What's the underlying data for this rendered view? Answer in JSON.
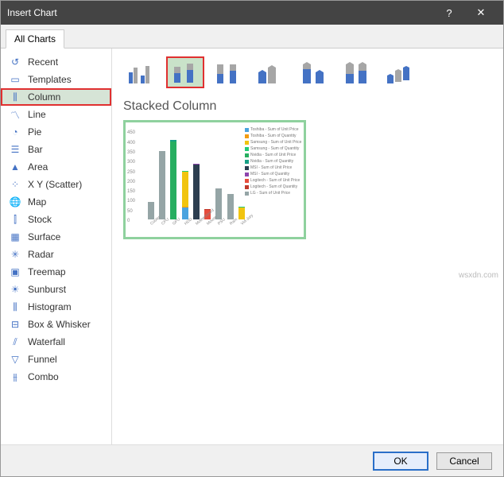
{
  "window": {
    "title": "Insert Chart",
    "help": "?",
    "close": "✕"
  },
  "tabs": {
    "all": "All Charts"
  },
  "sidebar": {
    "items": [
      {
        "label": "Recent"
      },
      {
        "label": "Templates"
      },
      {
        "label": "Column"
      },
      {
        "label": "Line"
      },
      {
        "label": "Pie"
      },
      {
        "label": "Bar"
      },
      {
        "label": "Area"
      },
      {
        "label": "X Y (Scatter)"
      },
      {
        "label": "Map"
      },
      {
        "label": "Stock"
      },
      {
        "label": "Surface"
      },
      {
        "label": "Radar"
      },
      {
        "label": "Treemap"
      },
      {
        "label": "Sunburst"
      },
      {
        "label": "Histogram"
      },
      {
        "label": "Box & Whisker"
      },
      {
        "label": "Waterfall"
      },
      {
        "label": "Funnel"
      },
      {
        "label": "Combo"
      }
    ],
    "selected_index": 2
  },
  "content": {
    "subtype_selected": 1,
    "chart_name": "Stacked Column"
  },
  "chart_data": {
    "type": "bar",
    "stacked": true,
    "title": "",
    "xlabel": "",
    "ylabel": "",
    "ylim": [
      0,
      480
    ],
    "yticks": [
      0,
      50,
      100,
      150,
      200,
      250,
      300,
      350,
      400,
      450
    ],
    "categories": [
      "Cooler",
      "CPU",
      "GPU",
      "HDD",
      "Motherboard",
      "Mouse",
      "PSU",
      "Ram",
      "Vid-Jury"
    ],
    "series": [
      {
        "name": "Toshiba - Sum of Unit Price",
        "color": "#4aa3df",
        "values": [
          0,
          0,
          0,
          60,
          0,
          0,
          0,
          0,
          0
        ]
      },
      {
        "name": "Toshiba - Sum of Quantity",
        "color": "#f39c12",
        "values": [
          0,
          0,
          0,
          5,
          0,
          0,
          0,
          0,
          0
        ]
      },
      {
        "name": "Samsung - Sum of Unit Price",
        "color": "#f1c40f",
        "values": [
          0,
          0,
          0,
          180,
          0,
          0,
          0,
          0,
          60
        ]
      },
      {
        "name": "Samsung - Sum of Quantity",
        "color": "#2c7",
        "values": [
          0,
          0,
          0,
          5,
          0,
          0,
          0,
          0,
          5
        ]
      },
      {
        "name": "Nvidia - Sum of Unit Price",
        "color": "#27ae60",
        "values": [
          0,
          0,
          400,
          0,
          0,
          0,
          0,
          0,
          0
        ]
      },
      {
        "name": "Nvidia - Sum of Quantity",
        "color": "#16a085",
        "values": [
          0,
          0,
          5,
          0,
          0,
          0,
          0,
          0,
          0
        ]
      },
      {
        "name": "MSI - Sum of Unit Price",
        "color": "#2c3e50",
        "values": [
          0,
          0,
          0,
          0,
          280,
          0,
          0,
          0,
          0
        ]
      },
      {
        "name": "MSI - Sum of Quantity",
        "color": "#8e44ad",
        "values": [
          0,
          0,
          0,
          0,
          5,
          0,
          0,
          0,
          0
        ]
      },
      {
        "name": "Logitech - Sum of Unit Price",
        "color": "#e74c3c",
        "values": [
          0,
          0,
          0,
          0,
          0,
          50,
          0,
          0,
          0
        ]
      },
      {
        "name": "Logitech - Sum of Quantity",
        "color": "#c0392b",
        "values": [
          0,
          0,
          0,
          0,
          0,
          5,
          0,
          0,
          0
        ]
      },
      {
        "name": "LG - Sum of Unit Price",
        "color": "#95a5a6",
        "values": [
          90,
          350,
          0,
          0,
          0,
          0,
          160,
          130,
          0
        ]
      }
    ]
  },
  "footer": {
    "ok": "OK",
    "cancel": "Cancel"
  },
  "watermark": "wsxdn.com"
}
